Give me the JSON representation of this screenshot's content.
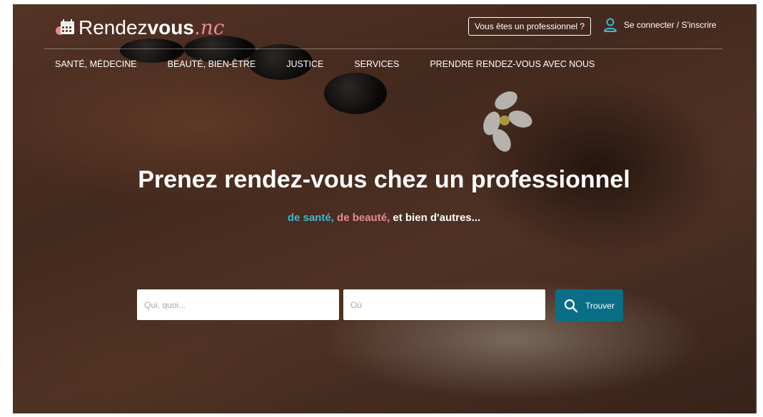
{
  "colors": {
    "accent": "#0a6f86",
    "health": "#3ab8d2",
    "beauty": "#e8899a"
  },
  "header": {
    "logo": {
      "icon": "calendar-icon",
      "prefix": "Rendez",
      "bold": "vous",
      "tld": ".nc"
    },
    "pro_button": "Vous êtes un professionnel ?",
    "login": {
      "icon": "user-icon",
      "label": "Se connecter / S'inscrire"
    }
  },
  "nav": {
    "items": [
      {
        "label": "SANTÉ, MÉDECINE"
      },
      {
        "label": "BEAUTÉ, BIEN-ÊTRE"
      },
      {
        "label": "JUSTICE"
      },
      {
        "label": "SERVICES"
      },
      {
        "label": "PRENDRE RENDEZ-VOUS AVEC NOUS"
      }
    ]
  },
  "hero": {
    "title": "Prenez rendez-vous chez un professionnel",
    "sub": {
      "sante": "de santé,",
      "beaute": "de beauté,",
      "rest": "et bien d'autres..."
    }
  },
  "search": {
    "what_placeholder": "Qui, quoi...",
    "where_placeholder": "Où",
    "button": {
      "icon": "search-icon",
      "label": "Trouver"
    }
  }
}
